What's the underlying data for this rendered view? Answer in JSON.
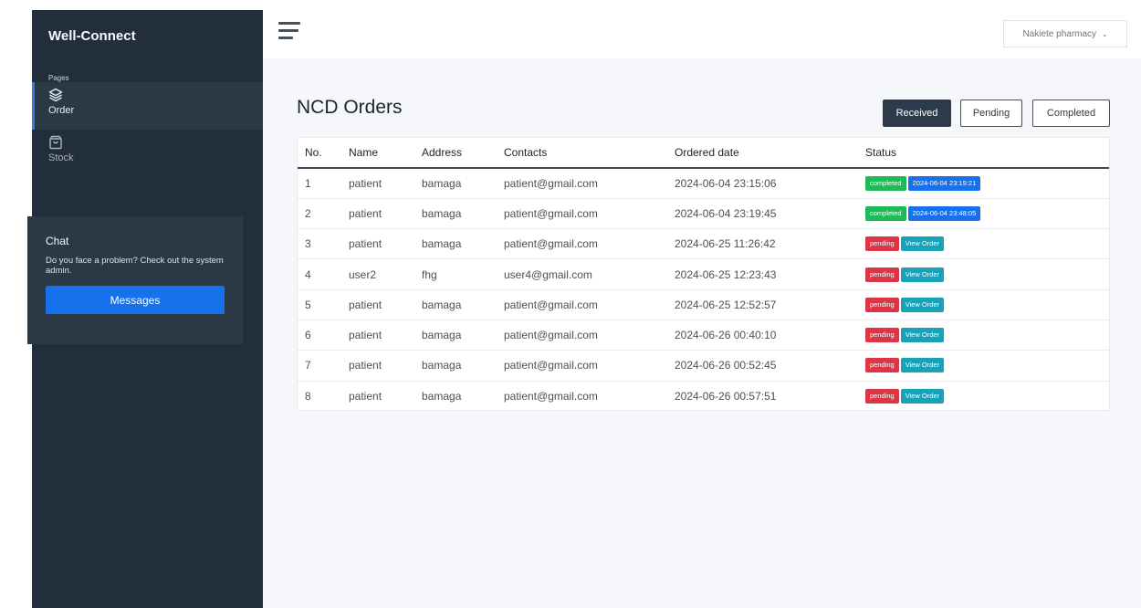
{
  "brand": "Well-Connect",
  "sidebar": {
    "section_label": "Pages",
    "items": [
      {
        "label": "Order",
        "icon": "layers-icon",
        "active": true
      },
      {
        "label": "Stock",
        "icon": "shopping-bag-icon",
        "active": false
      }
    ],
    "chat": {
      "title": "Chat",
      "text": "Do you face a problem? Check out the system admin.",
      "button_label": "Messages"
    }
  },
  "header": {
    "menu_icon": "hamburger-icon",
    "pharmacy": "Nakiete pharmacy",
    "chevron": "⌄"
  },
  "page": {
    "title": "NCD Orders",
    "filters": [
      "Received",
      "Pending",
      "Completed"
    ],
    "active_filter": "Received"
  },
  "table": {
    "headers": [
      "No.",
      "Name",
      "Address",
      "Contacts",
      "Ordered date",
      "Status"
    ],
    "rows": [
      {
        "no": "1",
        "name": "patient",
        "address": "bamaga",
        "contact": "patient@gmail.com",
        "date": "2024-06-04 23:15:06",
        "status": "completed",
        "extra": "2024-06-04 23:19:21"
      },
      {
        "no": "2",
        "name": "patient",
        "address": "bamaga",
        "contact": "patient@gmail.com",
        "date": "2024-06-04 23:19:45",
        "status": "completed",
        "extra": "2024-06-04 23:48:05"
      },
      {
        "no": "3",
        "name": "patient",
        "address": "bamaga",
        "contact": "patient@gmail.com",
        "date": "2024-06-25 11:26:42",
        "status": "pending",
        "extra": "View Order"
      },
      {
        "no": "4",
        "name": "user2",
        "address": "fhg",
        "contact": "user4@gmail.com",
        "date": "2024-06-25 12:23:43",
        "status": "pending",
        "extra": "View Order"
      },
      {
        "no": "5",
        "name": "patient",
        "address": "bamaga",
        "contact": "patient@gmail.com",
        "date": "2024-06-25 12:52:57",
        "status": "pending",
        "extra": "View Order"
      },
      {
        "no": "6",
        "name": "patient",
        "address": "bamaga",
        "contact": "patient@gmail.com",
        "date": "2024-06-26 00:40:10",
        "status": "pending",
        "extra": "View Order"
      },
      {
        "no": "7",
        "name": "patient",
        "address": "bamaga",
        "contact": "patient@gmail.com",
        "date": "2024-06-26 00:52:45",
        "status": "pending",
        "extra": "View Order"
      },
      {
        "no": "8",
        "name": "patient",
        "address": "bamaga",
        "contact": "patient@gmail.com",
        "date": "2024-06-26 00:57:51",
        "status": "pending",
        "extra": "View Order"
      }
    ]
  },
  "colors": {
    "sidebar": "#222e3c",
    "accent": "#1671ec",
    "completed": "#1cbb57",
    "pending": "#dc3545",
    "view": "#17a2b8"
  }
}
